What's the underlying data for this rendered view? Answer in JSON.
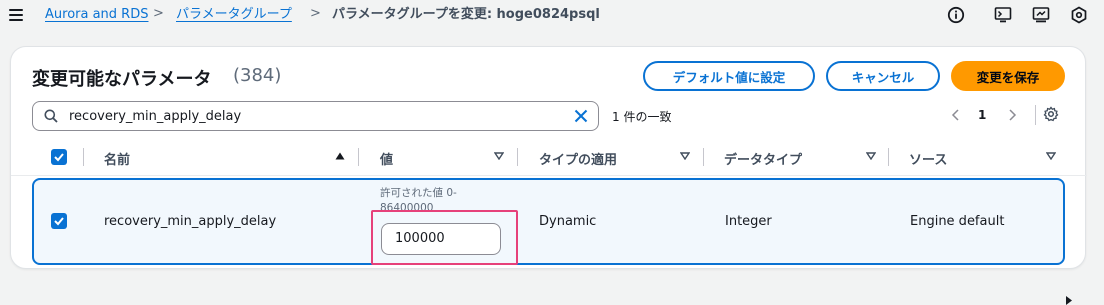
{
  "breadcrumb": {
    "items": [
      "Aurora and RDS",
      "パラメータグループ"
    ],
    "current": "パラメータグループを変更: hoge0824psql",
    "separator": ">"
  },
  "topbar_icons": [
    "info-icon",
    "cloudshell-icon",
    "notifications-icon",
    "settings-icon"
  ],
  "panel": {
    "title": "変更可能なパラメータ",
    "count": "(384)",
    "buttons": {
      "reset_default": "デフォルト値に設定",
      "cancel": "キャンセル",
      "save": "変更を保存"
    }
  },
  "search": {
    "value": "recovery_min_apply_delay",
    "match_text": "1 件の一致"
  },
  "pagination": {
    "current_page": "1"
  },
  "table": {
    "columns": [
      "名前",
      "値",
      "タイプの適用",
      "データタイプ",
      "ソース"
    ],
    "rows": [
      {
        "name": "recovery_min_apply_delay",
        "allowed_hint": "許可された値 0-86400000",
        "value": "100000",
        "apply_type": "Dynamic",
        "data_type": "Integer",
        "source": "Engine default",
        "selected": true
      }
    ]
  },
  "colors": {
    "accent": "#0972d3",
    "primary_button": "#ff9900",
    "highlight": "#e6417a",
    "selected_row_bg": "#f2f8fd"
  }
}
